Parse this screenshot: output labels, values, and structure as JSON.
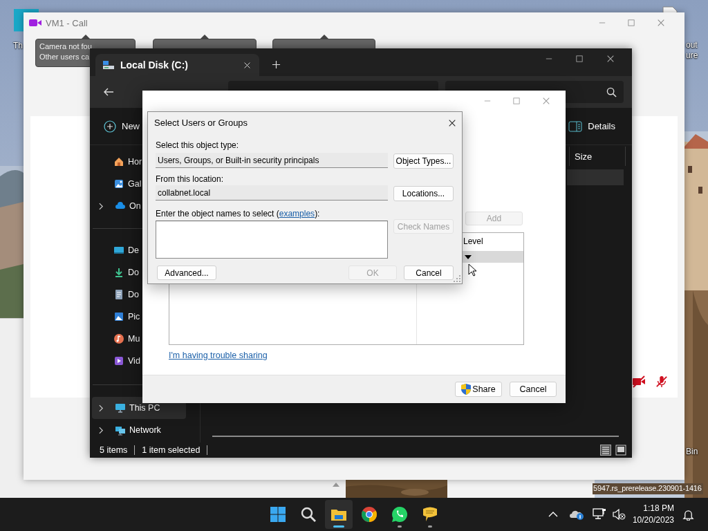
{
  "desktop": {
    "left_icon_label": "Th",
    "right_icon_label": [
      "out",
      "ure"
    ],
    "recycle_label": "Bin",
    "build_info": "5947.rs_prerelease.230901-1416"
  },
  "call_window": {
    "title": "VM1 - Call",
    "tooltips": [
      {
        "lines": [
          "Camera not fou",
          "Other users ca"
        ]
      }
    ],
    "camera_on": false,
    "microphone_on": false
  },
  "explorer": {
    "tab": {
      "title": "Local Disk (C:)"
    },
    "toolbar": {
      "new": "New",
      "details": "Details"
    },
    "columns": [
      "Size"
    ],
    "sidebar": {
      "groups": [
        [
          {
            "label": "Hor",
            "kind": "home",
            "expandable": false,
            "selected": false
          },
          {
            "label": "Gal",
            "kind": "gallery",
            "expandable": false,
            "selected": false
          },
          {
            "label": "On",
            "kind": "cloud",
            "expandable": true,
            "selected": false
          }
        ],
        [
          {
            "label": "De",
            "kind": "desktop",
            "expandable": false,
            "selected": false
          },
          {
            "label": "Do",
            "kind": "download",
            "expandable": false,
            "selected": false
          },
          {
            "label": "Do",
            "kind": "document",
            "expandable": false,
            "selected": false
          },
          {
            "label": "Pic",
            "kind": "pictures",
            "expandable": false,
            "selected": false
          },
          {
            "label": "Mu",
            "kind": "music",
            "expandable": false,
            "selected": false
          },
          {
            "label": "Vid",
            "kind": "video",
            "expandable": false,
            "selected": false
          }
        ],
        [
          {
            "label": "This PC",
            "kind": "pc",
            "expandable": true,
            "selected": true
          },
          {
            "label": "Network",
            "kind": "network",
            "expandable": true,
            "selected": false
          }
        ]
      ]
    },
    "status": [
      "5 items",
      "1 item selected"
    ]
  },
  "share_dialog": {
    "add_button": {
      "label": "Add",
      "disabled": true
    },
    "list_header": "Level",
    "link": "I'm having trouble sharing",
    "buttons": [
      {
        "label": "Share",
        "kind": "shield"
      },
      {
        "label": "Cancel",
        "kind": "plain"
      }
    ]
  },
  "select_dialog": {
    "title": "Select Users or Groups",
    "object_type_label": "Select this object type:",
    "object_type": "Users, Groups, or Built-in security principals",
    "object_types_button": "Object Types...",
    "location_label": "From this location:",
    "location": "collabnet.local",
    "locations_button": "Locations...",
    "names_label": "Enter the object names to select (",
    "examples_link": "examples",
    "names_label_end": "):",
    "check_names": {
      "label": "Check Names",
      "disabled": true
    },
    "buttons": [
      {
        "label": "Advanced...",
        "disabled": false
      },
      {
        "label": "OK",
        "disabled": true
      },
      {
        "label": "Cancel",
        "disabled": false
      }
    ]
  },
  "taskbar": {
    "apps": [
      {
        "kind": "start",
        "running": false,
        "selected": false
      },
      {
        "kind": "search",
        "running": false,
        "selected": false
      },
      {
        "kind": "explorer",
        "running": true,
        "selected": true
      },
      {
        "kind": "chrome",
        "running": false,
        "selected": false
      },
      {
        "kind": "whatsapp",
        "running": true,
        "selected": false
      },
      {
        "kind": "chat",
        "running": true,
        "selected": false
      }
    ],
    "tray": {
      "time": "1:18 PM",
      "date": "10/20/2023",
      "sound_muted": true
    }
  }
}
